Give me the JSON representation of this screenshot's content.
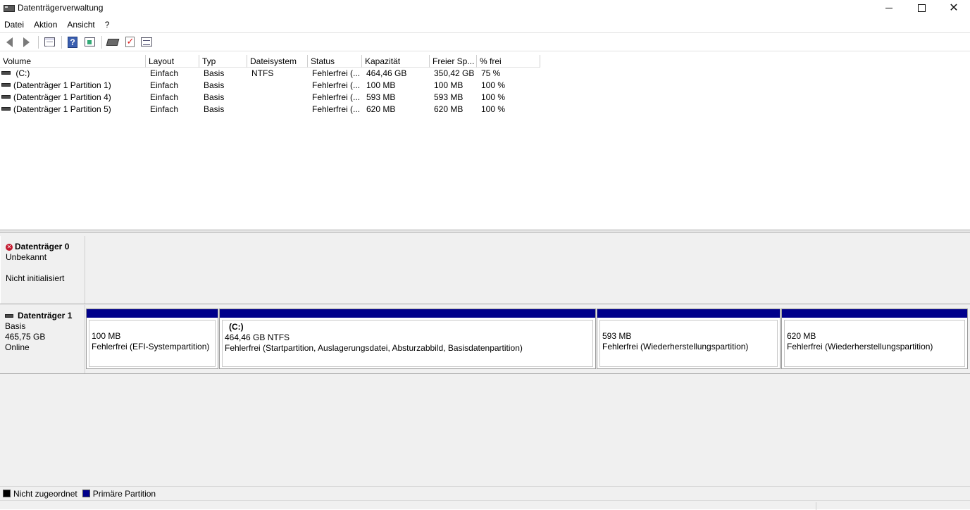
{
  "window": {
    "title": "Datenträgerverwaltung",
    "controls": {
      "minimize": "",
      "maximize": "",
      "close": "✕"
    }
  },
  "menu": {
    "items": [
      "Datei",
      "Aktion",
      "Ansicht",
      "?"
    ]
  },
  "toolbar": {
    "icons": [
      "back-arrow-icon",
      "forward-arrow-icon",
      "console-tree-icon",
      "help-icon",
      "show-hide-action-pane-icon",
      "rescan-disks-icon",
      "check-icon",
      "properties-icon"
    ],
    "help_glyph": "?"
  },
  "volume_list": {
    "columns": [
      "Volume",
      "Layout",
      "Typ",
      "Dateisystem",
      "Status",
      "Kapazität",
      "Freier Sp...",
      "% frei"
    ],
    "rows": [
      [
        "(C:)",
        "Einfach",
        "Basis",
        "NTFS",
        "Fehlerfrei (...",
        "464,46 GB",
        "350,42 GB",
        "75 %"
      ],
      [
        "(Datenträger 1 Partition 1)",
        "Einfach",
        "Basis",
        "",
        "Fehlerfrei (...",
        "100 MB",
        "100 MB",
        "100 %"
      ],
      [
        "(Datenträger 1 Partition 4)",
        "Einfach",
        "Basis",
        "",
        "Fehlerfrei (...",
        "593 MB",
        "593 MB",
        "100 %"
      ],
      [
        "(Datenträger 1 Partition 5)",
        "Einfach",
        "Basis",
        "",
        "Fehlerfrei (...",
        "620 MB",
        "620 MB",
        "100 %"
      ]
    ]
  },
  "disks": [
    {
      "name": "Datenträger 0",
      "type": "Unbekannt",
      "status": "Nicht initialisiert",
      "icon_glyph": "✕"
    },
    {
      "name": "Datenträger 1",
      "type": "Basis",
      "size": "465,75 GB",
      "status": "Online",
      "partitions": [
        {
          "name": "",
          "size": "100 MB",
          "status": "Fehlerfrei (EFI-Systempartition)"
        },
        {
          "name": "(C:)",
          "size": "464,46 GB NTFS",
          "status": "Fehlerfrei (Startpartition, Auslagerungsdatei, Absturzabbild, Basisdatenpartition)"
        },
        {
          "name": "",
          "size": "593 MB",
          "status": "Fehlerfrei (Wiederherstellungspartition)"
        },
        {
          "name": "",
          "size": "620 MB",
          "status": "Fehlerfrei (Wiederherstellungspartition)"
        }
      ]
    }
  ],
  "legend": [
    {
      "label": "Nicht zugeordnet",
      "color": "#000000"
    },
    {
      "label": "Primäre Partition",
      "color": "#00008b"
    }
  ],
  "colors": {
    "primary_partition": "#00008b",
    "unallocated": "#000000"
  }
}
